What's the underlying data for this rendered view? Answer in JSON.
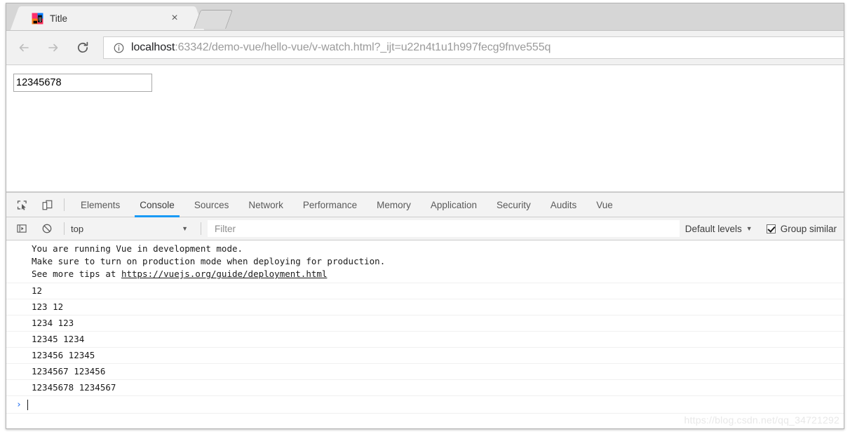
{
  "browser": {
    "tab": {
      "title": "Title",
      "favicon": "intellij-idea-icon",
      "close_label": "×"
    },
    "new_tab_label": "",
    "nav": {
      "back": "back-arrow-icon",
      "forward": "forward-arrow-icon",
      "reload": "reload-icon"
    },
    "omnibox": {
      "site_info_icon": "info-circle-icon",
      "url_host": "localhost",
      "url_rest": ":63342/demo-vue/hello-vue/v-watch.html?_ijt=u22n4t1u1h997fecg9fnve555q",
      "full_url": "localhost:63342/demo-vue/hello-vue/v-watch.html?_ijt=u22n4t1u1h997fecg9fnve555q"
    }
  },
  "page": {
    "text_input_value": "12345678",
    "text_input_placeholder": ""
  },
  "devtools": {
    "icons": {
      "inspect": "inspect-element-icon",
      "device": "device-toolbar-icon"
    },
    "tabs": [
      {
        "label": "Elements",
        "active": false
      },
      {
        "label": "Console",
        "active": true
      },
      {
        "label": "Sources",
        "active": false
      },
      {
        "label": "Network",
        "active": false
      },
      {
        "label": "Performance",
        "active": false
      },
      {
        "label": "Memory",
        "active": false
      },
      {
        "label": "Application",
        "active": false
      },
      {
        "label": "Security",
        "active": false
      },
      {
        "label": "Audits",
        "active": false
      },
      {
        "label": "Vue",
        "active": false
      }
    ],
    "active_tab_underline_color": "#1a9af5",
    "console_toolbar": {
      "sidebar_toggle_icon": "show-console-sidebar-icon",
      "clear_icon": "clear-console-icon",
      "context_value": "top",
      "context_caret": "▼",
      "filter_placeholder": "Filter",
      "filter_value": "",
      "levels_label": "Default levels",
      "levels_caret": "▼",
      "group_similar_label": "Group similar",
      "group_similar_checked": true
    },
    "console_messages": [
      {
        "type": "info-block",
        "lines": [
          "You are running Vue in development mode.",
          "Make sure to turn on production mode when deploying for production.",
          "See more tips at "
        ],
        "link_text": "https://vuejs.org/guide/deployment.html"
      },
      {
        "type": "log",
        "text": "12"
      },
      {
        "type": "log",
        "text": "123 12"
      },
      {
        "type": "log",
        "text": "1234 123"
      },
      {
        "type": "log",
        "text": "12345 1234"
      },
      {
        "type": "log",
        "text": "123456 12345"
      },
      {
        "type": "log",
        "text": "1234567 123456"
      },
      {
        "type": "log",
        "text": "12345678 1234567"
      }
    ],
    "prompt": {
      "chevron": "›",
      "value": ""
    }
  },
  "watermark": {
    "text": "https://blog.csdn.net/qq_34721292"
  }
}
